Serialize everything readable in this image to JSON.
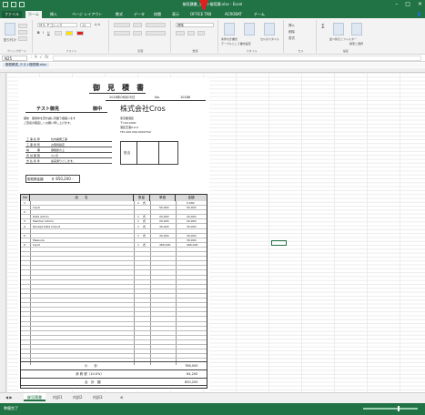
{
  "titlebar": {
    "title": "御見積書_テスト御見積.xlsx - Excel"
  },
  "tabs": [
    "ファイル",
    "ホーム",
    "挿入",
    "ページ レイアウト",
    "数式",
    "データ",
    "校閲",
    "表示",
    "OFFICE TAB",
    "ACROBAT",
    "チーム"
  ],
  "active_tab_index": 1,
  "ribbon_groups": [
    "クリップボード",
    "フォント",
    "配置",
    "数値",
    "スタイル",
    "セル",
    "編集"
  ],
  "ribbon": {
    "font_name": "ＭＳ Ｐゴシック",
    "font_size": "11",
    "number_format": "標準",
    "paste": "貼り付け",
    "cond_format": "条件付き書式",
    "table_format": "テーブルとして書式設定",
    "cell_style": "セルのスタイル",
    "insert": "挿入",
    "delete": "削除",
    "format": "書式",
    "sort": "並べ替えとフィルター",
    "find": "検索と選択"
  },
  "formula_bar": {
    "name_box": "N25",
    "fx": "fx",
    "value": ""
  },
  "doc_tab": "御見積書_テスト御見積.xlsx",
  "document": {
    "title": "御　見　積　書",
    "date": "2018年06月05日",
    "no_label": "No.",
    "no_value": "10186",
    "customer": "テスト御見",
    "honorific": "御中",
    "company": "株式会社Cros",
    "notice_line1": "御依　御用命を頂き誠に有難う御座います",
    "notice_line2": "ご査収の程宜しくお願い申し上げます。",
    "addr1": "東京都港区",
    "addr2": "〒100-0000",
    "addr3": "港区芝浦0-0-0",
    "tel": "TEL 000-000-0000 FAX",
    "fields": [
      {
        "k": "工 事 名 称",
        "v": "社内開発工事"
      },
      {
        "k": "工 事 場 所",
        "v": "お客様指定"
      },
      {
        "k": "納　　　期",
        "v": "御相談の上"
      },
      {
        "k": "有 効 期 限",
        "v": "3ヶ月"
      },
      {
        "k": "支 払 条 件",
        "v": "従来通りとします。"
      }
    ],
    "stamp_label": "担当",
    "amount_label": "御見積金額",
    "amount_value": "￥ 850,200 -",
    "headers": [
      "No",
      "品　　名",
      "数量",
      "単価",
      "金額"
    ],
    "items": [
      {
        "no": "1",
        "name": "",
        "qty": "1",
        "unit": "式",
        "price": "",
        "amount": "5,000"
      },
      {
        "no": "",
        "name": "Input",
        "qty": "",
        "unit": "",
        "price": "50,000",
        "amount": "50,000"
      },
      {
        "no": "2",
        "name": "",
        "qty": "",
        "unit": "",
        "price": "",
        "amount": ""
      },
      {
        "no": "",
        "name": "Data Admin",
        "qty": "1",
        "unit": "式",
        "price": "20,000",
        "amount": "20,000"
      },
      {
        "no": "3",
        "name": "Member Admin",
        "qty": "1",
        "unit": "式",
        "price": "20,000",
        "amount": "20,000"
      },
      {
        "no": "4",
        "name": "Receipt Data Import",
        "qty": "1",
        "unit": "式",
        "price": "30,000",
        "amount": "30,000"
      },
      {
        "no": "",
        "name": "",
        "qty": "",
        "unit": "",
        "price": "",
        "amount": ""
      },
      {
        "no": "5",
        "name": "",
        "qty": "1",
        "unit": "式",
        "price": "30,000",
        "amount": "30,000"
      },
      {
        "no": "",
        "name": "Measure",
        "qty": "",
        "unit": "",
        "price": "",
        "amount": "30,000"
      },
      {
        "no": "6",
        "name": "Input",
        "qty": "1",
        "unit": "式",
        "price": "466,000",
        "amount": "466,000"
      }
    ],
    "subtotal_label": "小　　計",
    "subtotal_value": "786,000",
    "tax_label": "消 費 税（10.0%）",
    "tax_value": "64,200",
    "total_label": "合　計　額",
    "total_value": "850,200"
  },
  "sheet_tabs": [
    "御見積書",
    "内訳1",
    "内訳2",
    "内訳3"
  ],
  "active_sheet_index": 0,
  "status": {
    "ready": "準備完了",
    "page": ""
  }
}
